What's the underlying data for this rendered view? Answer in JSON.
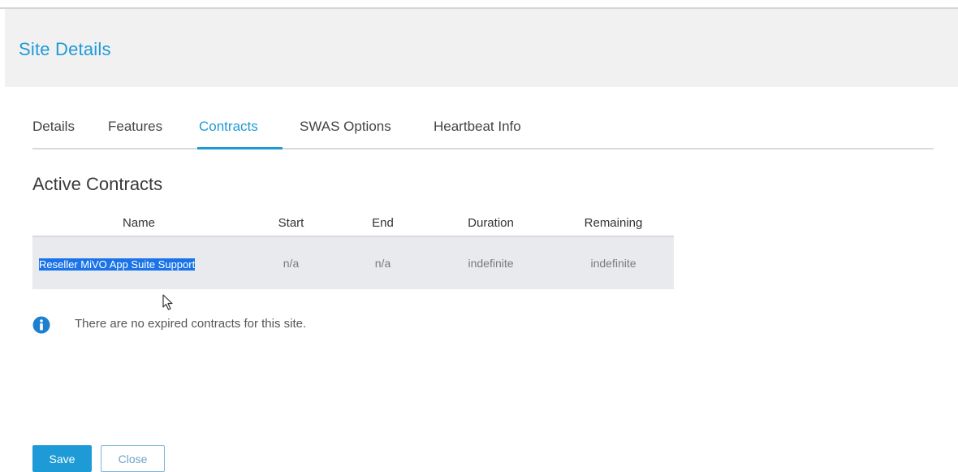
{
  "header": {
    "title": "Site Details"
  },
  "tabs": [
    {
      "label": "Details",
      "active": false
    },
    {
      "label": "Features",
      "active": false
    },
    {
      "label": "Contracts",
      "active": true
    },
    {
      "label": "SWAS Options",
      "active": false
    },
    {
      "label": "Heartbeat Info",
      "active": false
    }
  ],
  "active_contracts": {
    "title": "Active Contracts",
    "columns": [
      "Name",
      "Start",
      "End",
      "Duration",
      "Remaining"
    ],
    "rows": [
      {
        "name": "Reseller MiVO App Suite Support",
        "start": "n/a",
        "end": "n/a",
        "duration": "indefinite",
        "remaining": "indefinite"
      }
    ]
  },
  "expired_contracts": {
    "message": "There are no expired contracts for this site.",
    "icon": "info-icon"
  },
  "actions": {
    "save_label": "Save",
    "close_label": "Close"
  },
  "colors": {
    "accent": "#1e9ad6",
    "header_bg": "#f1f1f2",
    "row_bg": "#e8eaee",
    "selection": "#1a73e8"
  }
}
